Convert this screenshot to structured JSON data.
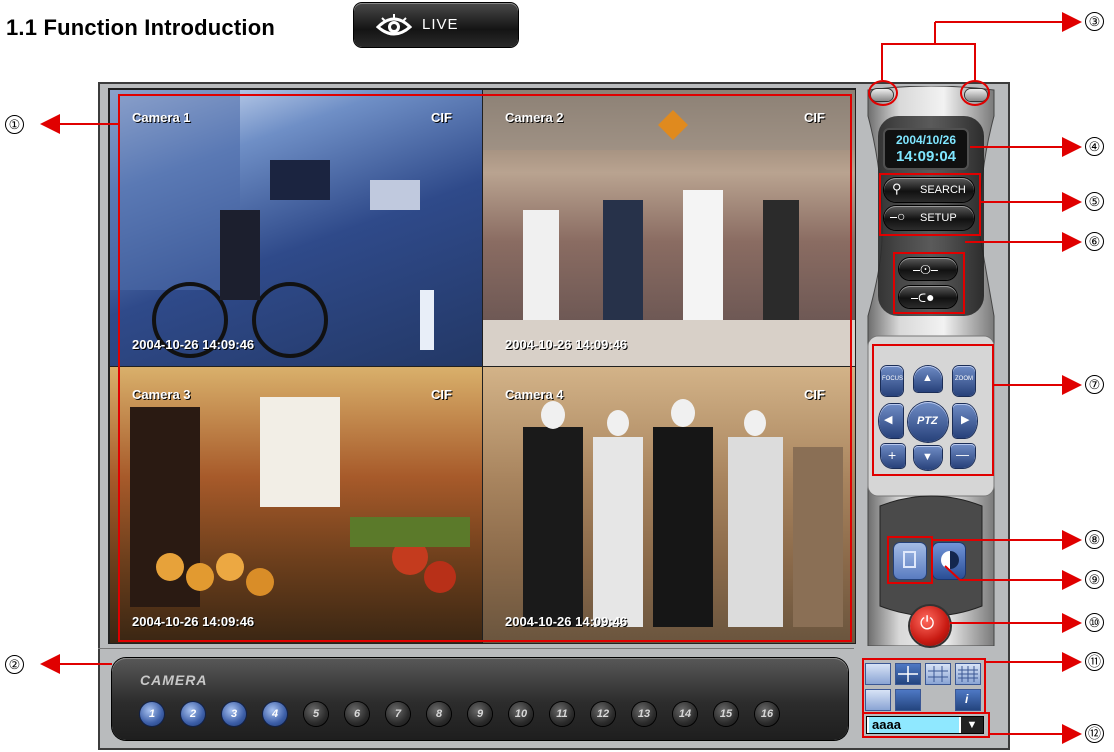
{
  "heading": "1.1 Function Introduction",
  "live_badge": {
    "label": "LIVE",
    "icon": "eye-icon"
  },
  "tiles": [
    {
      "camera": "Camera 1",
      "resolution": "CIF",
      "timestamp": "2004-10-26 14:09:46"
    },
    {
      "camera": "Camera 2",
      "resolution": "CIF",
      "timestamp": "2004-10-26 14:09:46"
    },
    {
      "camera": "Camera 3",
      "resolution": "CIF",
      "timestamp": "2004-10-26 14:09:46"
    },
    {
      "camera": "Camera 4",
      "resolution": "CIF",
      "timestamp": "2004-10-26 14:09:46"
    }
  ],
  "panel": {
    "clock_date": "2004/10/26",
    "clock_time": "14:09:04",
    "search_label": "SEARCH",
    "setup_label": "SETUP",
    "ptz_label": "PTZ",
    "focus_label": "FOCUS",
    "zoom_label": "ZOOM",
    "plus": "+",
    "minus": "—"
  },
  "camera_strip": {
    "title": "CAMERA",
    "buttons": [
      "1",
      "2",
      "3",
      "4",
      "5",
      "6",
      "7",
      "8",
      "9",
      "10",
      "11",
      "12",
      "13",
      "14",
      "15",
      "16"
    ],
    "active_count": 4
  },
  "user_select": {
    "value": "aaaa"
  },
  "callouts": [
    "①",
    "②",
    "③",
    "④",
    "⑤",
    "⑥",
    "⑦",
    "⑧",
    "⑨",
    "⑩",
    "⑪",
    "⑫"
  ],
  "colors": {
    "callout_red": "#e00000",
    "clock_text": "#7fe6ff",
    "active_camera": "#3d5fa8"
  }
}
